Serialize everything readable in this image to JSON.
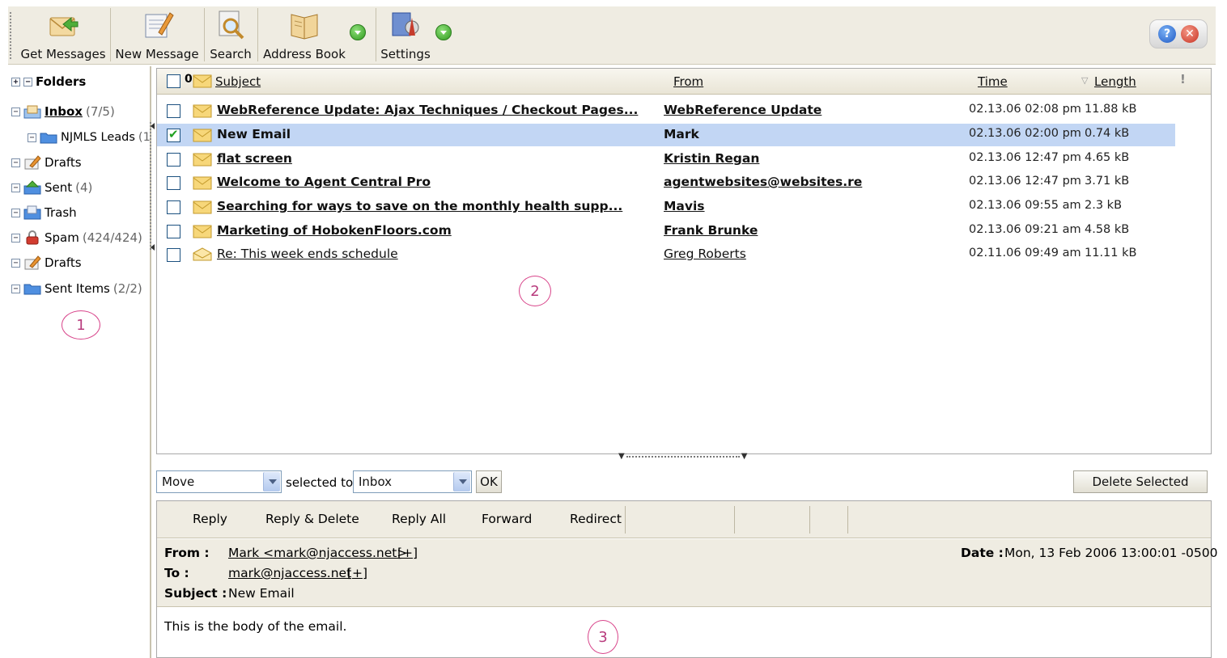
{
  "toolbar": {
    "buttons": [
      {
        "label": "Get Messages",
        "icon": "get-messages-icon"
      },
      {
        "label": "New Message",
        "icon": "new-message-icon"
      },
      {
        "label": "Search",
        "icon": "search-icon"
      },
      {
        "label": "Address Book",
        "icon": "address-book-icon"
      },
      {
        "label": "Settings",
        "icon": "settings-icon"
      }
    ],
    "help_glyph": "?",
    "close_glyph": "✕"
  },
  "sidebar": {
    "title": "Folders",
    "folders": [
      {
        "name": "Inbox",
        "count": "(7/5)",
        "icon": "inbox-icon"
      },
      {
        "name": "NJMLS Leads",
        "count": "(1",
        "icon": "folder-icon"
      },
      {
        "name": "Drafts",
        "count": "",
        "icon": "drafts-icon"
      },
      {
        "name": "Sent",
        "count": "(4)",
        "icon": "sent-icon"
      },
      {
        "name": "Trash",
        "count": "",
        "icon": "trash-icon"
      },
      {
        "name": "Spam",
        "count": "(424/424)",
        "icon": "spam-icon"
      },
      {
        "name": "Drafts",
        "count": "",
        "icon": "drafts-icon"
      },
      {
        "name": "Sent Items",
        "count": "(2/2)",
        "icon": "folder-icon"
      }
    ],
    "annotation": "1"
  },
  "list": {
    "columns": {
      "subject": "Subject",
      "from": "From",
      "time": "Time",
      "length": "Length",
      "priority": "!"
    },
    "attach_glyph": "0",
    "rows": [
      {
        "subject": "WebReference Update: Ajax Techniques / Checkout Pages...",
        "from": "WebReference Update",
        "time": "02.13.06 02:08 pm",
        "length": "11.88 kB",
        "unread": true,
        "selected": false,
        "checked": false
      },
      {
        "subject": "New Email",
        "from": "Mark",
        "time": "02.13.06 02:00 pm",
        "length": "0.74 kB",
        "unread": true,
        "selected": true,
        "checked": true
      },
      {
        "subject": "flat screen",
        "from": "Kristin Regan",
        "time": "02.13.06 12:47 pm",
        "length": "4.65 kB",
        "unread": true,
        "selected": false,
        "checked": false
      },
      {
        "subject": "Welcome to Agent Central Pro",
        "from": "agentwebsites@websites.re",
        "time": "02.13.06 12:47 pm",
        "length": "3.71 kB",
        "unread": true,
        "selected": false,
        "checked": false
      },
      {
        "subject": "Searching for ways to save on the monthly health supp...",
        "from": "Mavis",
        "time": "02.13.06 09:55 am",
        "length": "2.3 kB",
        "unread": true,
        "selected": false,
        "checked": false
      },
      {
        "subject": "Marketing of HobokenFloors.com",
        "from": "Frank Brunke",
        "time": "02.13.06 09:21 am",
        "length": "4.58 kB",
        "unread": true,
        "selected": false,
        "checked": false
      },
      {
        "subject": "Re: This week ends schedule",
        "from": "Greg Roberts",
        "time": "02.11.06 09:49 am",
        "length": "11.11 kB",
        "unread": false,
        "selected": false,
        "checked": false
      }
    ],
    "annotation": "2"
  },
  "actions": {
    "action_select": "Move",
    "selected_to_label": "selected to",
    "folder_select": "Inbox",
    "ok_label": "OK",
    "delete_label": "Delete Selected"
  },
  "reader": {
    "toolbar": [
      "Reply",
      "Reply & Delete",
      "Reply All",
      "Forward",
      "Redirect"
    ],
    "from_label": "From :",
    "from_value": "Mark <mark@njaccess.net>",
    "to_label": "To :",
    "to_value": "mark@njaccess.net",
    "expand_label": "[+]",
    "subject_label": "Subject :",
    "subject_value": "New Email",
    "date_label": "Date :",
    "date_value": "Mon, 13 Feb 2006 13:00:01 -0500",
    "body": "This is the body of the email.",
    "annotation": "3"
  }
}
